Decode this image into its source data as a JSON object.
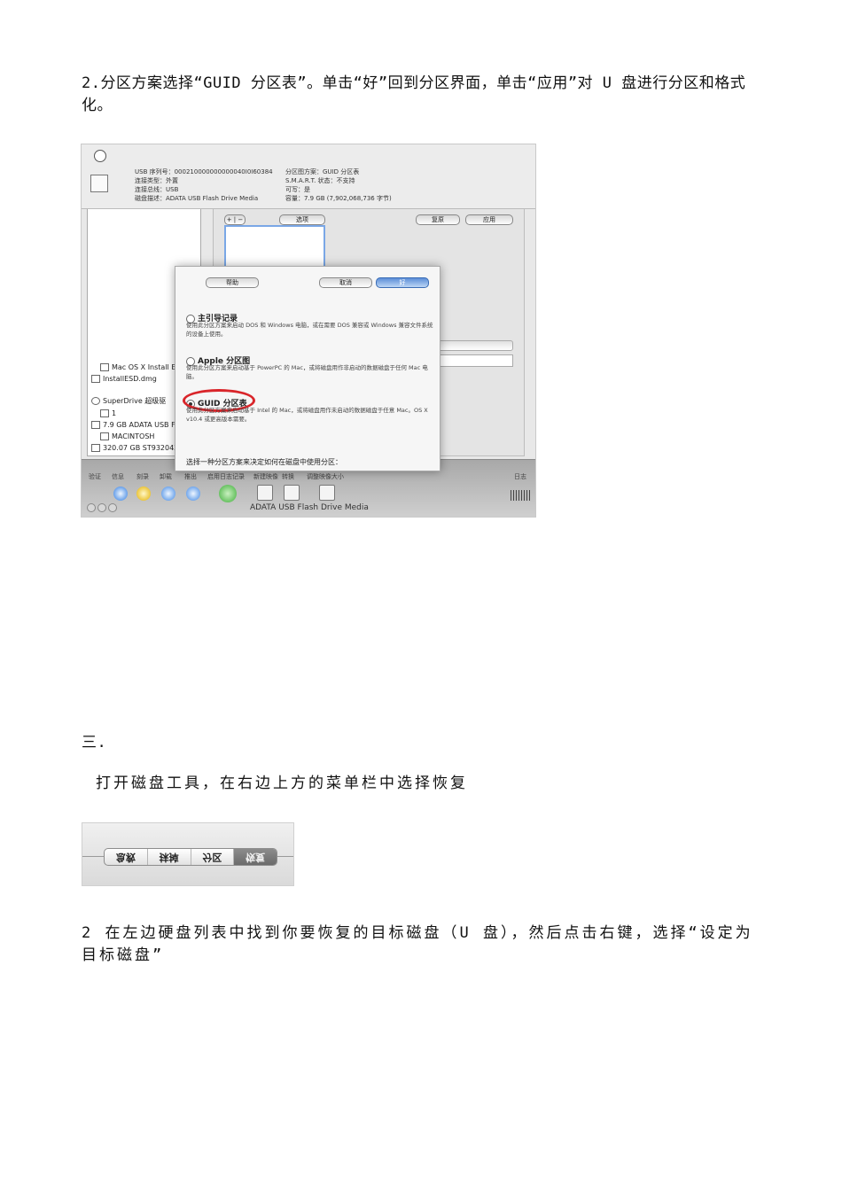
{
  "paragraphs": {
    "p1": "2.分区方案选择“GUID 分区表”。单击“好”回到分区界面，单击“应用”对 U 盘进行分区和格式化。",
    "p2": "三.",
    "p3": "打开磁盘工具，在右边上方的菜单栏中选择恢复",
    "p4": "2 在左边硬盘列表中找到你要恢复的目标磁盘（U 盘），然后点击右键，选择“设定为目标磁盘”"
  },
  "screenshot1": {
    "window_title": "ADATA USB Flash Drive Media",
    "toolbar": [
      "验证",
      "信息",
      "刻录",
      "卸载",
      "推出",
      "启用日志记录",
      "新建映像",
      "转换",
      "调整映像大小"
    ],
    "toolbar_right": "日志",
    "info": {
      "l1": "USB 序列号：000210000000000040I0I60384",
      "l2": "连接类型：外置",
      "l3": "连接总线：USB",
      "l4": "磁盘描述：ADATA USB Flash Drive Media",
      "r1": "分区图方案：GUID 分区表",
      "r2": "S.M.A.R.T. 状态：不支持",
      "r3": "可写：是",
      "r4": "容量：7.9 GB (7,902,068,736 字节)"
    },
    "sidebar": [
      "320.07 GB ST9320423",
      "MACINTOSH",
      "7.9 GB ADATA USB Fl",
      "1",
      "SuperDrive 超级驱",
      "InstallESD.dmg",
      "Mac OS X Install ESD"
    ],
    "main_buttons": [
      "选项",
      "复原",
      "应用"
    ],
    "sheet": {
      "heading": "选择一种分区方案来决定如何在磁盘中使用分区：",
      "options": [
        {
          "label": "GUID 分区表",
          "desc": "使用此分区方案来启动基于 Intel 的 Mac，或将磁盘用作未启动的数据磁盘于任意 Mac。OS X v10.4 或更高版本需要。",
          "selected": true
        },
        {
          "label": "Apple 分区图",
          "desc": "使用此分区方案来启动基于 PowerPC 的 Mac，或将磁盘用作非启动的数据磁盘于任何 Mac 电脑。",
          "selected": false
        },
        {
          "label": "主引导记录",
          "desc": "使用此分区方案来启动 DOS 和 Windows 电脑，或在需要 DOS 兼容或 Windows 兼容文件系统的设备上使用。",
          "selected": false
        }
      ],
      "buttons": {
        "help": "帮助",
        "cancel": "取消",
        "ok": "好"
      }
    }
  },
  "screenshot2": {
    "segments": [
      "急救",
      "抹掉",
      "分区",
      "恢复"
    ],
    "active": 3
  }
}
